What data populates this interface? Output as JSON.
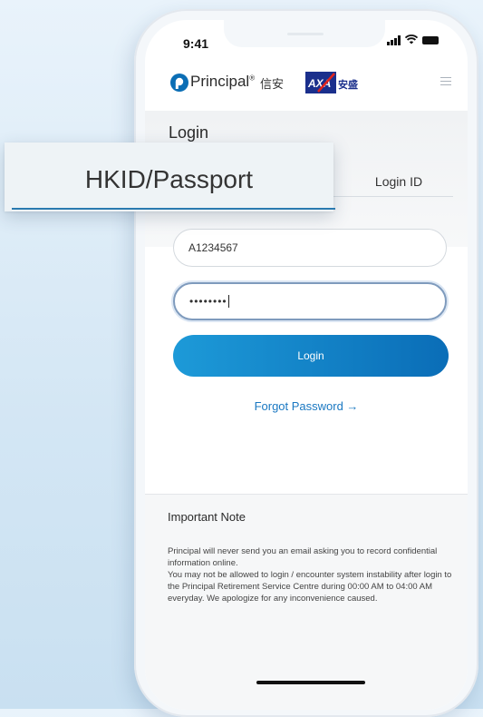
{
  "status": {
    "time": "9:41"
  },
  "header": {
    "brand": "Principal",
    "brand_suffix": "®",
    "brand_cn": "信安",
    "partner": "AXA",
    "partner_cn": "安盛"
  },
  "login": {
    "title": "Login",
    "tabs": [
      {
        "label": "HKID/Passport",
        "active": true
      },
      {
        "label": "Login ID",
        "active": false
      }
    ],
    "user_value": "A1234567",
    "password_masked": "••••••••",
    "submit_label": "Login",
    "forgot_label": "Forgot Password →"
  },
  "note": {
    "title": "Important Note",
    "paragraphs": [
      "Principal will never send you an email asking you to record confidential information online.",
      "You may not be allowed to login / encounter system instability after login to the Principal Retirement Service Centre during 00:00 AM to 04:00 AM everyday. We apologize for any inconvenience caused."
    ]
  },
  "colors": {
    "accent": "#1a78c2",
    "button_start": "#1d9ad8",
    "button_end": "#0a6db7",
    "axa_blue": "#1a2f8c",
    "axa_red": "#e2231a"
  },
  "icons": [
    "principal-logo-icon",
    "axa-logo-icon",
    "signal-icon",
    "wifi-icon",
    "battery-icon",
    "menu-icon"
  ]
}
